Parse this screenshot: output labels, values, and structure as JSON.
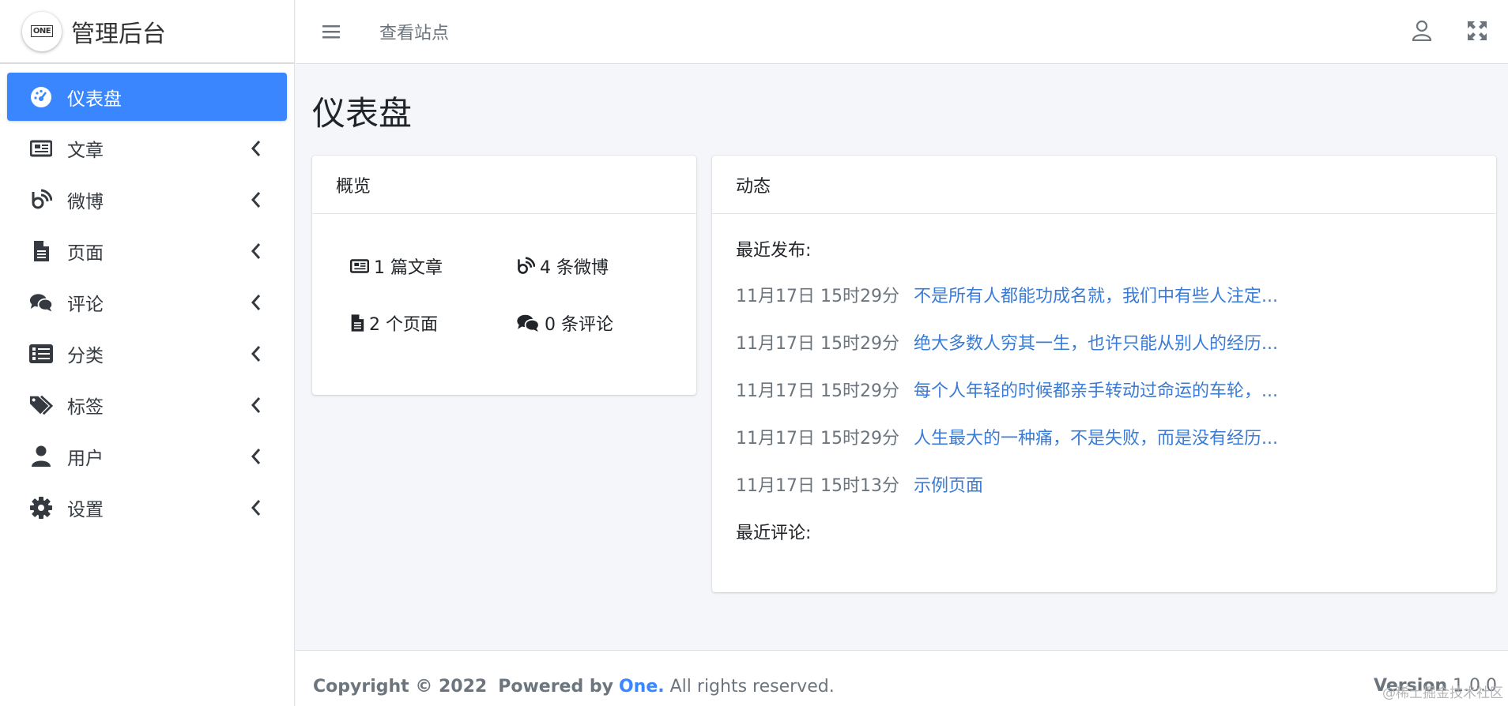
{
  "brand": {
    "logo_text": "ONE",
    "title": "管理后台"
  },
  "sidebar": {
    "items": [
      {
        "label": "仪表盘",
        "icon": "dashboard-icon",
        "active": true
      },
      {
        "label": "文章",
        "icon": "newspaper-icon"
      },
      {
        "label": "微博",
        "icon": "weibo-icon"
      },
      {
        "label": "页面",
        "icon": "file-icon"
      },
      {
        "label": "评论",
        "icon": "comments-icon"
      },
      {
        "label": "分类",
        "icon": "list-icon"
      },
      {
        "label": "标签",
        "icon": "tags-icon"
      },
      {
        "label": "用户",
        "icon": "user-icon"
      },
      {
        "label": "设置",
        "icon": "gear-icon"
      }
    ]
  },
  "topbar": {
    "view_site": "查看站点"
  },
  "page": {
    "title": "仪表盘"
  },
  "overview": {
    "title": "概览",
    "articles": "1 篇文章",
    "weibo": "4 条微博",
    "pages": "2 个页面",
    "comments": "0 条评论"
  },
  "activity": {
    "title": "动态",
    "recent_posts_label": "最近发布:",
    "posts": [
      {
        "time": "11月17日 15时29分",
        "title": "不是所有人都能功成名就，我们中有些人注定..."
      },
      {
        "time": "11月17日 15时29分",
        "title": "绝大多数人穷其一生，也许只能从别人的经历..."
      },
      {
        "time": "11月17日 15时29分",
        "title": "每个人年轻的时候都亲手转动过命运的车轮，..."
      },
      {
        "time": "11月17日 15时29分",
        "title": "人生最大的一种痛，不是失败，而是没有经历..."
      },
      {
        "time": "11月17日 15时13分",
        "title": "示例页面"
      }
    ],
    "recent_comments_label": "最近评论:"
  },
  "footer": {
    "copyright": "Copyright © 2022",
    "powered_by": "Powered by",
    "brand": "One.",
    "rights": "All rights reserved.",
    "version_label": "Version",
    "version": "1.0.0"
  },
  "watermark": "@稀土掘金技术社区",
  "colors": {
    "accent": "#3a86ff",
    "link": "#3a7bd5",
    "background": "#f4f6f9"
  }
}
